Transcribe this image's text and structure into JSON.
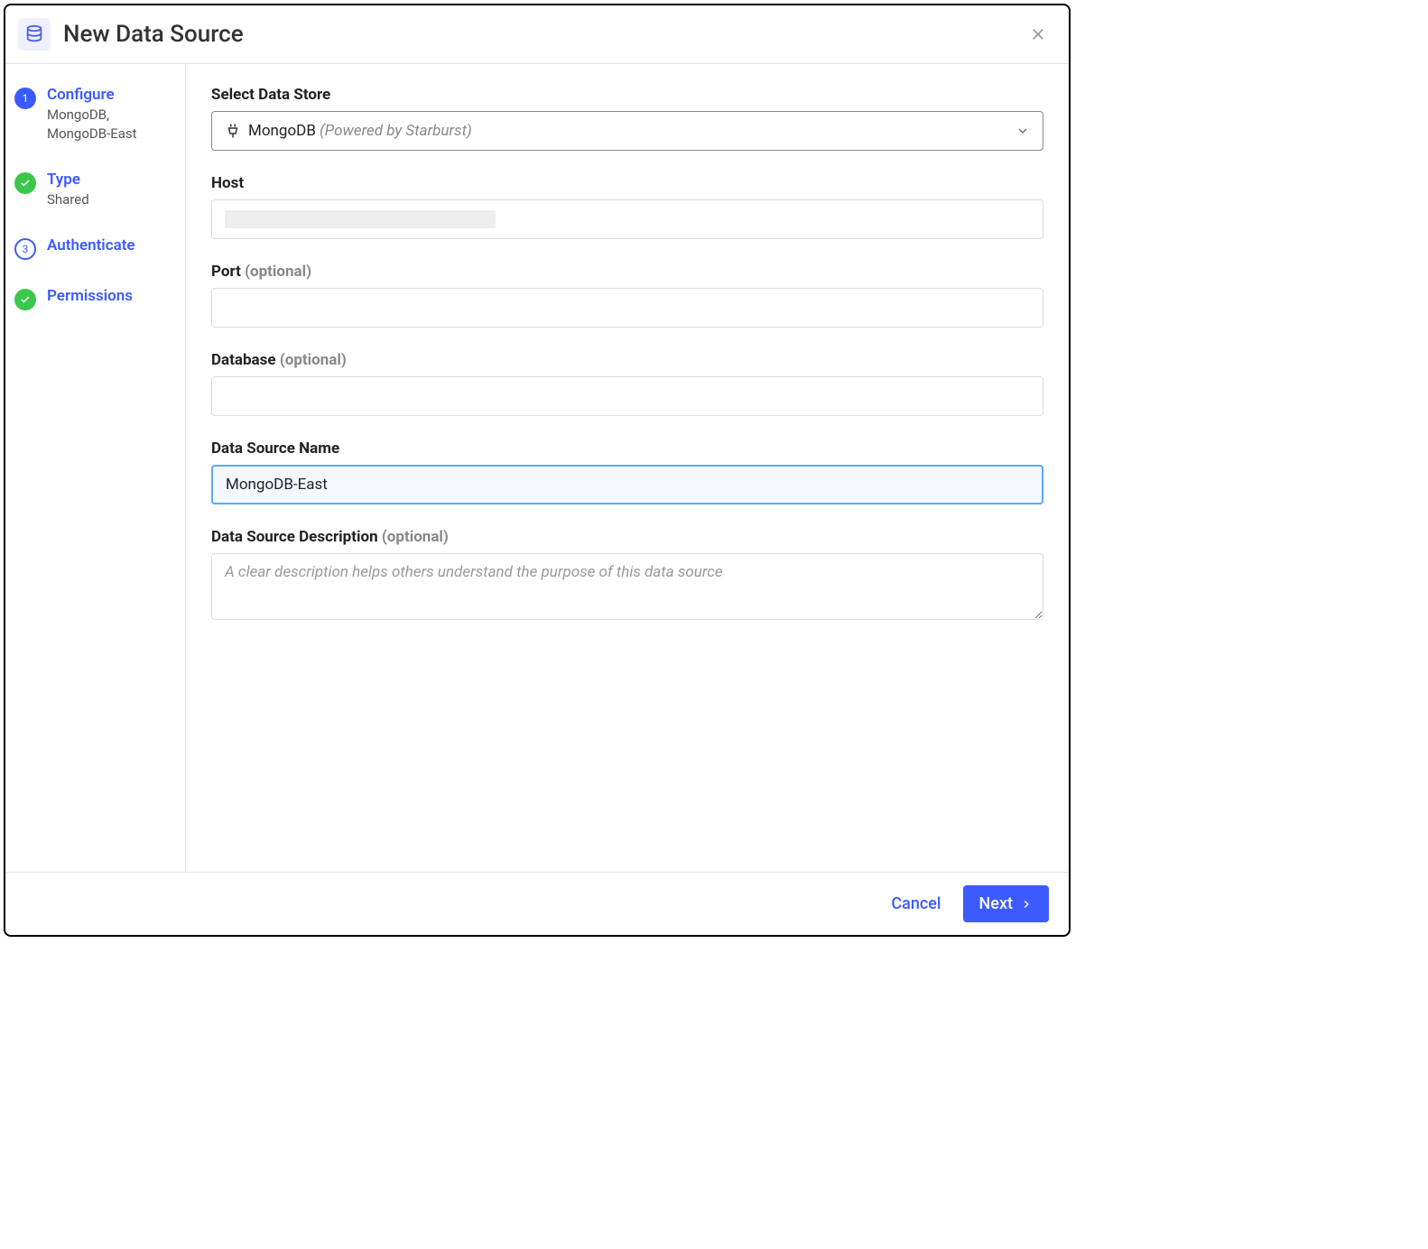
{
  "header": {
    "title": "New Data Source"
  },
  "sidebar": {
    "steps": [
      {
        "number": "1",
        "status": "active",
        "title": "Configure",
        "subtitle": "MongoDB, MongoDB-East"
      },
      {
        "number": "2",
        "status": "done",
        "title": "Type",
        "subtitle": "Shared"
      },
      {
        "number": "3",
        "status": "pending",
        "title": "Authenticate",
        "subtitle": ""
      },
      {
        "number": "4",
        "status": "done",
        "title": "Permissions",
        "subtitle": ""
      }
    ]
  },
  "form": {
    "data_store": {
      "label": "Select Data Store",
      "value": "MongoDB",
      "value_suffix": "(Powered by Starburst)"
    },
    "host": {
      "label": "Host",
      "value": ""
    },
    "port": {
      "label": "Port",
      "optional_text": "(optional)",
      "value": ""
    },
    "database": {
      "label": "Database",
      "optional_text": "(optional)",
      "value": ""
    },
    "name": {
      "label": "Data Source Name",
      "value": "MongoDB-East"
    },
    "description": {
      "label": "Data Source Description",
      "optional_text": "(optional)",
      "placeholder": "A clear description helps others understand the purpose of this data source",
      "value": ""
    }
  },
  "footer": {
    "cancel": "Cancel",
    "next": "Next"
  }
}
